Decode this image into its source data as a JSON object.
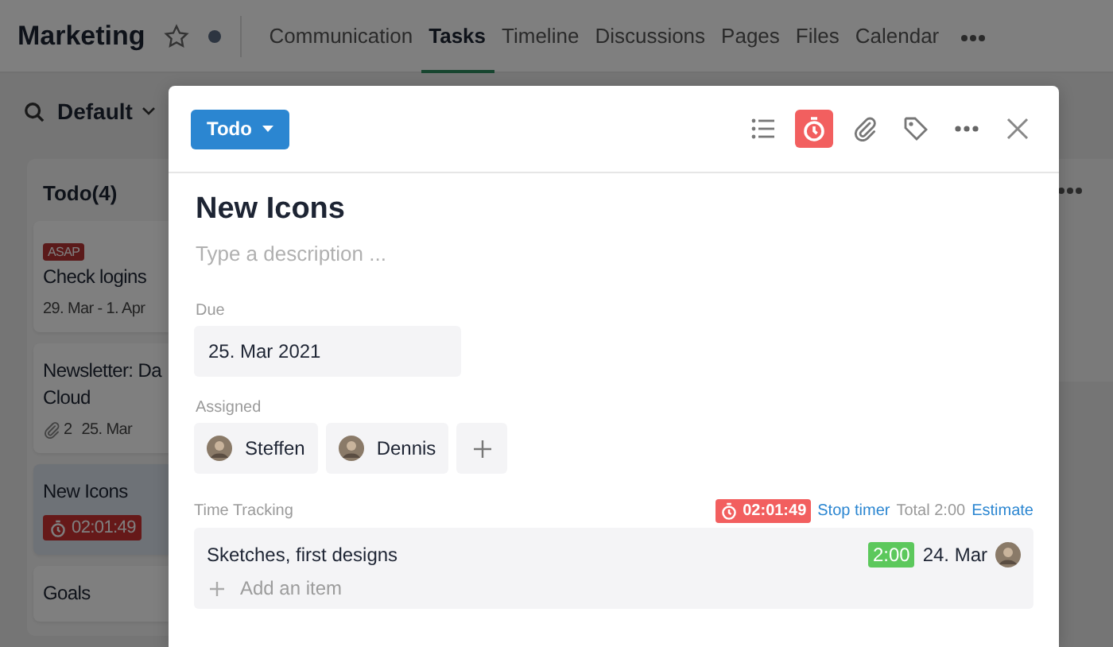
{
  "header": {
    "title": "Marketing",
    "starred": false,
    "tabs": [
      {
        "label": "Communication",
        "selected": false
      },
      {
        "label": "Tasks",
        "selected": true
      },
      {
        "label": "Timeline",
        "selected": false
      },
      {
        "label": "Discussions",
        "selected": false
      },
      {
        "label": "Pages",
        "selected": false
      },
      {
        "label": "Files",
        "selected": false
      },
      {
        "label": "Calendar",
        "selected": false
      }
    ]
  },
  "toolbar": {
    "view": "Default"
  },
  "board": {
    "columns": [
      {
        "title": "Todo(4)",
        "cards": [
          {
            "selected": false,
            "tags": [
              "ASAP"
            ],
            "title_lines": [
              "Check logins"
            ],
            "meta": [
              {
                "kind": "date",
                "text": "29. Mar - 1. Apr"
              }
            ]
          },
          {
            "selected": false,
            "title_lines": [
              "Newsletter: Da",
              "Cloud"
            ],
            "meta": [
              {
                "kind": "attachments",
                "text": "2"
              },
              {
                "kind": "date",
                "text": "25. Mar"
              }
            ]
          },
          {
            "selected": true,
            "title_lines": [
              "New Icons"
            ],
            "meta": [
              {
                "kind": "timer",
                "text": "02:01:49"
              }
            ]
          },
          {
            "selected": false,
            "title_lines": [
              "Goals"
            ]
          }
        ]
      }
    ]
  },
  "modal": {
    "status": "Todo",
    "timer_active": true,
    "title": "New Icons",
    "description": {
      "placeholder": "Type a description ..."
    },
    "due": {
      "label": "Due",
      "value": "25. Mar 2021"
    },
    "assigned": {
      "label": "Assigned",
      "people": [
        {
          "name": "Steffen"
        },
        {
          "name": "Dennis"
        }
      ]
    },
    "time_tracking": {
      "label": "Time Tracking",
      "running": "02:01:49",
      "stop": "Stop timer",
      "total": "Total 2:00",
      "estimate": "Estimate",
      "entries": [
        {
          "text": "Sketches, first designs",
          "duration": "2:00",
          "date": "24. Mar"
        }
      ],
      "add": {
        "placeholder": "Add an item"
      }
    }
  }
}
